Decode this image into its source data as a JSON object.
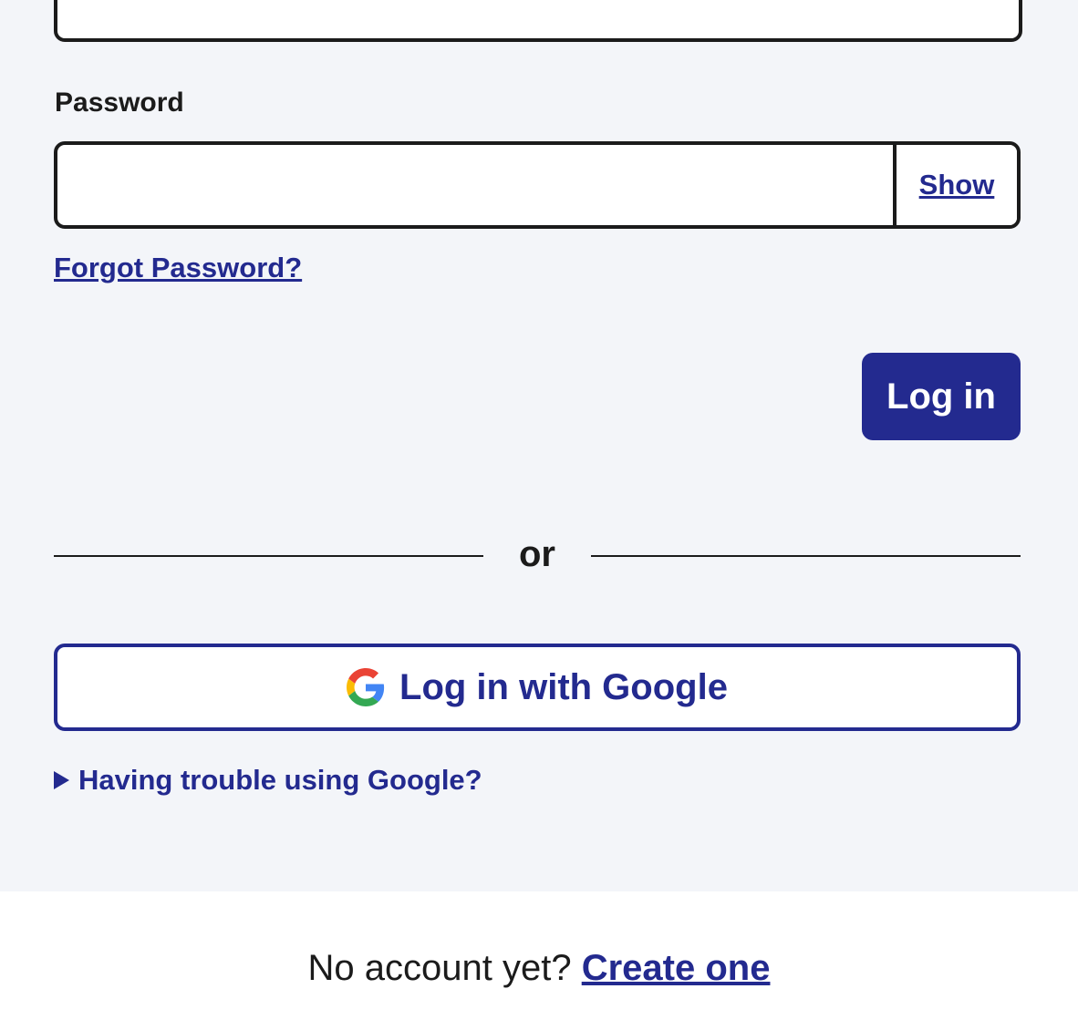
{
  "form": {
    "password_label": "Password",
    "password_value": "",
    "show_label": "Show",
    "forgot_label": "Forgot Password?",
    "login_label": "Log in"
  },
  "divider": {
    "text": "or"
  },
  "google": {
    "button_label": "Log in with Google",
    "icon": "google-g-icon",
    "trouble_label": "Having trouble using Google?"
  },
  "footer": {
    "prompt": "No account yet?",
    "link_label": "Create one"
  },
  "colors": {
    "accent": "#232a8f",
    "panel_bg": "#f3f5f9",
    "text": "#1b1b1b"
  }
}
